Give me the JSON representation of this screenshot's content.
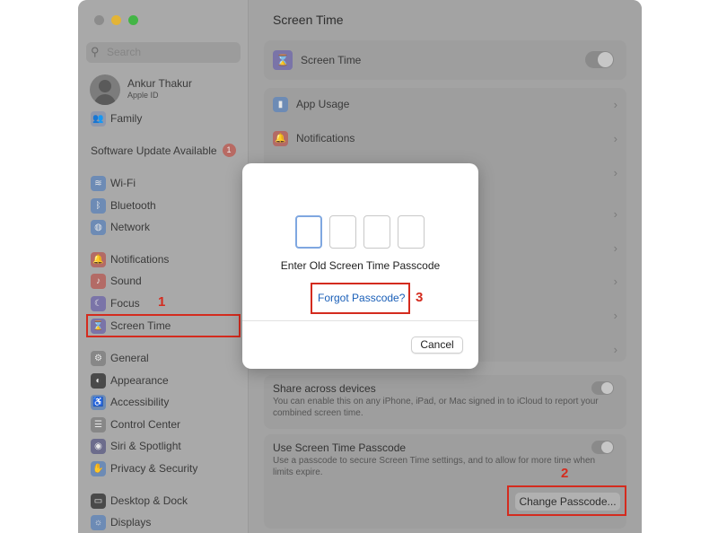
{
  "sidebar": {
    "search_placeholder": "Search",
    "user": {
      "name": "Ankur Thakur",
      "subtitle": "Apple ID"
    },
    "family": "Family",
    "software_update": {
      "label": "Software Update Available",
      "badge": "1"
    },
    "items": {
      "wifi": "Wi-Fi",
      "bluetooth": "Bluetooth",
      "network": "Network",
      "notifications": "Notifications",
      "sound": "Sound",
      "focus": "Focus",
      "screen_time": "Screen Time",
      "general": "General",
      "appearance": "Appearance",
      "accessibility": "Accessibility",
      "control_center": "Control Center",
      "siri": "Siri & Spotlight",
      "privacy": "Privacy & Security",
      "desktop": "Desktop & Dock",
      "displays": "Displays"
    }
  },
  "main": {
    "title": "Screen Time",
    "screen_time_row": "Screen Time",
    "app_usage": "App Usage",
    "notifications": "Notifications",
    "share": {
      "title": "Share across devices",
      "desc": "You can enable this on any iPhone, iPad, or Mac signed in to iCloud to report your combined screen time."
    },
    "passcode": {
      "title": "Use Screen Time Passcode",
      "desc": "Use a passcode to secure Screen Time settings, and to allow for more time when limits expire."
    },
    "change_button": "Change Passcode..."
  },
  "modal": {
    "prompt": "Enter Old Screen Time Passcode",
    "forgot": "Forgot Passcode?",
    "cancel": "Cancel"
  },
  "annotations": {
    "a1": "1",
    "a2": "2",
    "a3": "3"
  }
}
